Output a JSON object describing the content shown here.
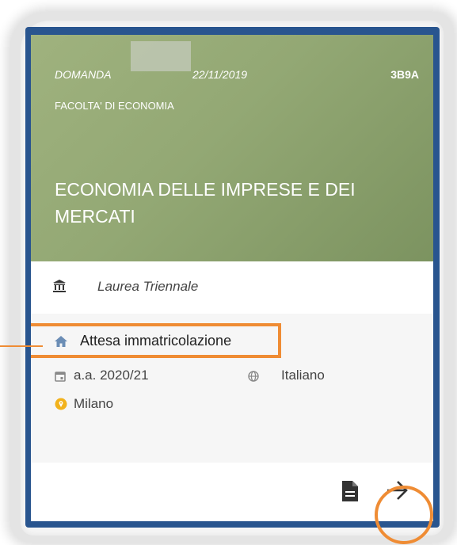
{
  "card": {
    "request_label": "DOMANDA",
    "request_date": "22/11/2019",
    "code": "3B9A",
    "faculty": "FACOLTA' DI ECONOMIA",
    "title": "ECONOMIA DELLE IMPRESE E DEI MERCATI",
    "degree_type": "Laurea  Triennale",
    "status": "Attesa immatricolazione",
    "academic_year": "a.a.  2020/21",
    "language": "Italiano",
    "location": "Milano"
  },
  "colors": {
    "hero_bg": "#93a874",
    "card_border": "#29558f",
    "highlight": "#ef8c34",
    "location_pin": "#f2b21c"
  },
  "icons": {
    "degree": "institution-icon",
    "status": "home-icon",
    "year": "calendar-icon",
    "language": "globe-icon",
    "location": "location-pin-icon",
    "document": "document-icon",
    "next": "arrow-right-icon"
  }
}
